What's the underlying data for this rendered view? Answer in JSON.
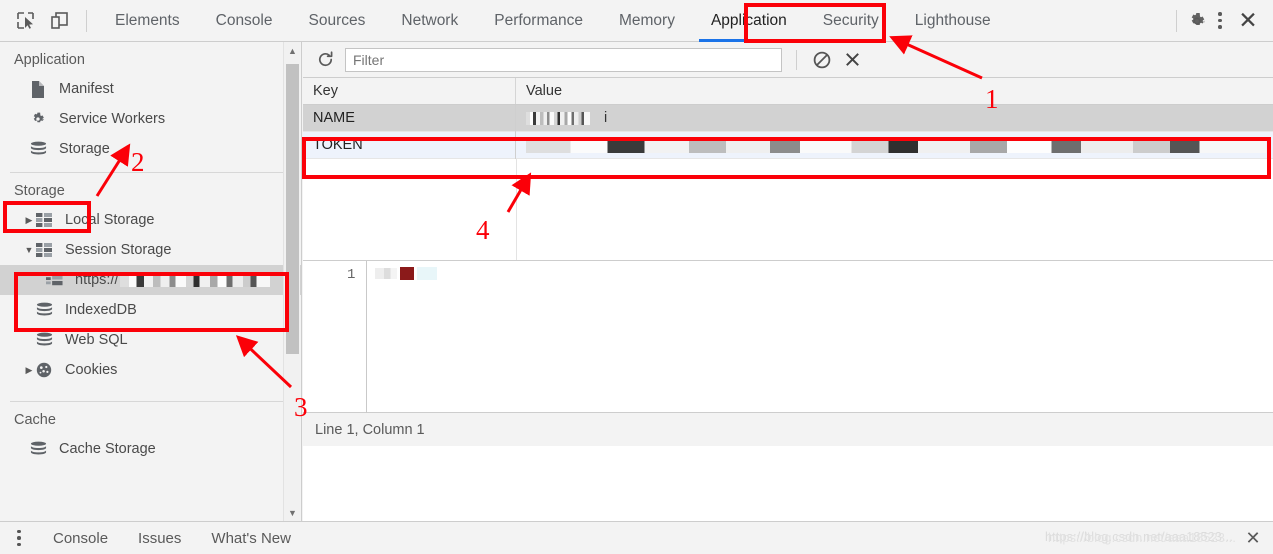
{
  "topbar": {
    "icons": [
      {
        "name": "inspect-element-icon"
      },
      {
        "name": "device-toolbar-icon"
      }
    ],
    "tabs": [
      {
        "label": "Elements",
        "active": false
      },
      {
        "label": "Console",
        "active": false
      },
      {
        "label": "Sources",
        "active": false
      },
      {
        "label": "Network",
        "active": false
      },
      {
        "label": "Performance",
        "active": false
      },
      {
        "label": "Memory",
        "active": false
      },
      {
        "label": "Application",
        "active": true
      },
      {
        "label": "Security",
        "active": false
      },
      {
        "label": "Lighthouse",
        "active": false
      }
    ],
    "settings_icon": "gear-icon",
    "more_icon": "kebab-menu-icon",
    "close_icon": "close-icon"
  },
  "sidebar": {
    "application_header": "Application",
    "application_items": [
      {
        "label": "Manifest",
        "icon": "document-icon"
      },
      {
        "label": "Service Workers",
        "icon": "gear-icon"
      },
      {
        "label": "Storage",
        "icon": "database-icon"
      }
    ],
    "storage_header": "Storage",
    "storage_items": [
      {
        "label": "Local Storage",
        "icon": "table-icon",
        "twisty": "▶",
        "expanded": false
      },
      {
        "label": "Session Storage",
        "icon": "table-icon",
        "twisty": "▼",
        "expanded": true
      },
      {
        "label": "IndexedDB",
        "icon": "database-icon",
        "twisty": "",
        "expanded": false
      },
      {
        "label": "Web SQL",
        "icon": "database-icon",
        "twisty": "",
        "expanded": false
      },
      {
        "label": "Cookies",
        "icon": "cookie-icon",
        "twisty": "▶",
        "expanded": false
      }
    ],
    "session_origin": {
      "label": "https://",
      "icon": "frame-icon",
      "redacted": true,
      "selected": true
    },
    "cache_header": "Cache",
    "cache_items": [
      {
        "label": "Cache Storage",
        "icon": "database-icon"
      }
    ],
    "scrollbar": {
      "up_arrow": "▲",
      "down_arrow": "▼"
    }
  },
  "main": {
    "toolbar": {
      "refresh_icon": "refresh-icon",
      "filter_placeholder": "Filter",
      "filter_value": "",
      "clear_all_icon": "clear-all-icon",
      "delete_selected_icon": "delete-selected-icon"
    },
    "table": {
      "columns": [
        "Key",
        "Value"
      ],
      "rows": [
        {
          "key": "NAME",
          "value": "",
          "value_redacted": true,
          "state": "selected-inactive"
        },
        {
          "key": "TOKEN",
          "value": "",
          "value_redacted": true,
          "state": "selected"
        }
      ]
    },
    "preview": {
      "line_number": "1",
      "content_redacted": true
    },
    "status": "Line 1, Column 1"
  },
  "drawer": {
    "more_icon": "kebab-menu-icon",
    "tabs": [
      "Console",
      "Issues",
      "What's New"
    ],
    "watermark": "https://blog.csdn.net/aaa18523...",
    "close_icon": "close-icon"
  },
  "annotations": {
    "color": "#fb0008",
    "markers": [
      {
        "number": "1",
        "target": "application-tab"
      },
      {
        "number": "2",
        "target": "storage-section-header"
      },
      {
        "number": "3",
        "target": "session-storage-origin"
      },
      {
        "number": "4",
        "target": "token-row"
      }
    ]
  }
}
